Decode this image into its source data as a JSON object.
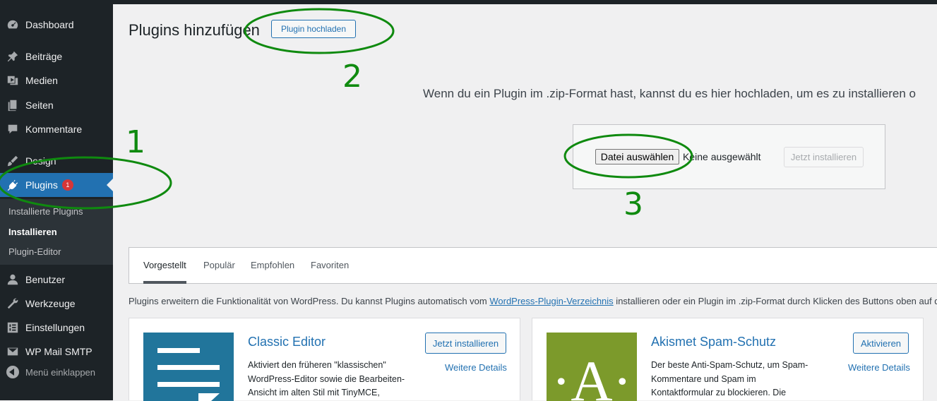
{
  "sidebar": {
    "items": [
      {
        "label": "Dashboard",
        "icon": "dashboard-icon"
      },
      {
        "label": "Beiträge",
        "icon": "pin-icon"
      },
      {
        "label": "Medien",
        "icon": "media-icon"
      },
      {
        "label": "Seiten",
        "icon": "pages-icon"
      },
      {
        "label": "Kommentare",
        "icon": "comment-icon"
      },
      {
        "label": "Design",
        "icon": "brush-icon"
      },
      {
        "label": "Plugins",
        "icon": "plug-icon",
        "badge": "1"
      },
      {
        "label": "Benutzer",
        "icon": "user-icon"
      },
      {
        "label": "Werkzeuge",
        "icon": "wrench-icon"
      },
      {
        "label": "Einstellungen",
        "icon": "settings-icon"
      },
      {
        "label": "WP Mail SMTP",
        "icon": "mail-icon"
      }
    ],
    "submenu": [
      "Installierte Plugins",
      "Installieren",
      "Plugin-Editor"
    ],
    "collapse_label": "Menü einklappen"
  },
  "page": {
    "title": "Plugins hinzufügen",
    "upload_button": "Plugin hochladen",
    "upload_description": "Wenn du ein Plugin im .zip-Format hast, kannst du es hier hochladen, um es zu installieren o",
    "file_button": "Datei auswählen",
    "file_status": "Keine ausgewählt",
    "install_button": "Jetzt installieren"
  },
  "tabs": [
    "Vorgestellt",
    "Populär",
    "Empfohlen",
    "Favoriten"
  ],
  "intro": {
    "before": "Plugins erweitern die Funktionalität von WordPress. Du kannst Plugins automatisch vom ",
    "link": "WordPress-Plugin-Verzeichnis",
    "after": " installieren oder ein Plugin im .zip-Format durch Klicken des Buttons oben auf die"
  },
  "cards": [
    {
      "title": "Classic Editor",
      "description_lines": [
        "Aktiviert den früheren \"klassischen\"",
        "WordPress-Editor sowie die Bearbeiten-",
        "Ansicht im alten Stil mit TinyMCE,"
      ],
      "action": "Jetzt installieren",
      "details": "Weitere Details",
      "icon_color": "#21759b"
    },
    {
      "title": "Akismet Spam-Schutz",
      "description_lines": [
        "Der beste Anti-Spam-Schutz, um Spam-",
        "Kommentare und Spam im",
        "Kontaktformular zu blockieren. Die"
      ],
      "action": "Aktivieren",
      "details": "Weitere Details",
      "icon_color": "#7c9a2b",
      "icon_letter": "·A·"
    }
  ],
  "annotations": [
    "1",
    "2",
    "3"
  ],
  "colors": {
    "annotation": "#0f8a0f",
    "accent": "#2271b1",
    "sidebar": "#1d2327"
  }
}
